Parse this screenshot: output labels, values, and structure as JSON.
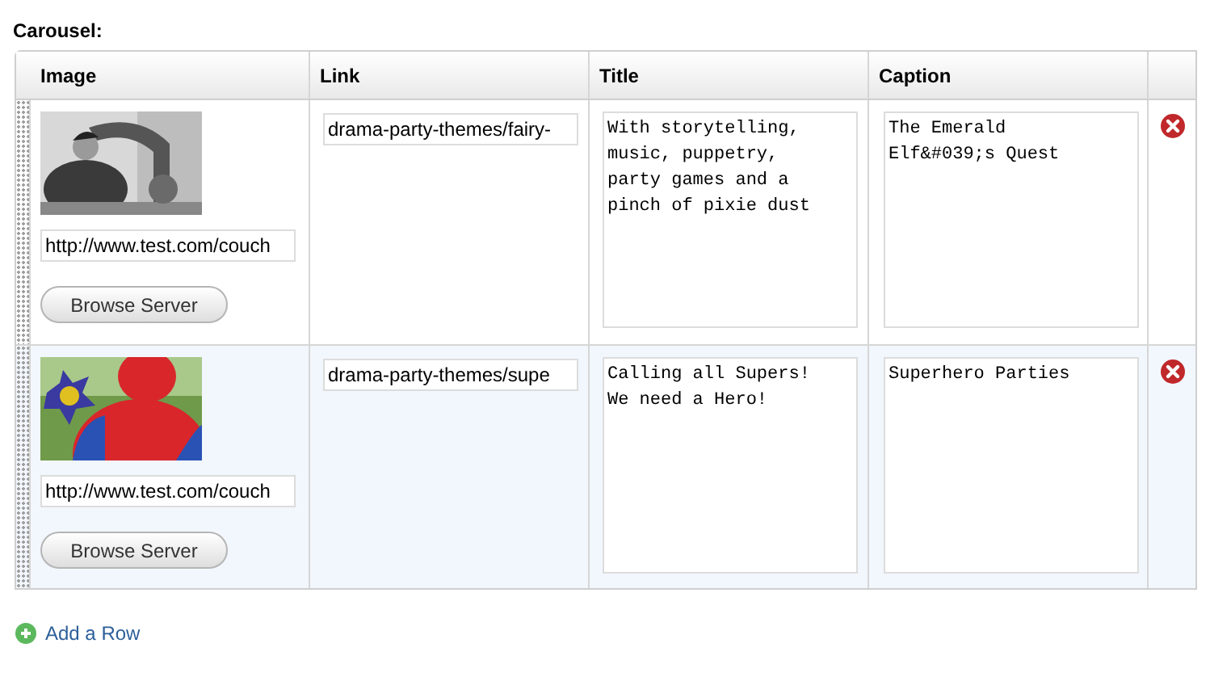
{
  "section": {
    "label": "Carousel:"
  },
  "table": {
    "columns": [
      "Image",
      "Link",
      "Title",
      "Caption"
    ],
    "rows": [
      {
        "selected": false,
        "image_url": "http://www.test.com/couch",
        "browse_button": "Browse Server",
        "link": "drama-party-themes/fairy-",
        "title": "With storytelling,\nmusic, puppetry,\nparty games and a\npinch of pixie dust",
        "caption": "The Emerald\nElf&#039;s Quest"
      },
      {
        "selected": true,
        "image_url": "http://www.test.com/couch",
        "browse_button": "Browse Server",
        "link": "drama-party-themes/supe",
        "title": "Calling all Supers!\nWe need a Hero!",
        "caption": "Superhero Parties"
      }
    ]
  },
  "add_row": "Add a Row"
}
